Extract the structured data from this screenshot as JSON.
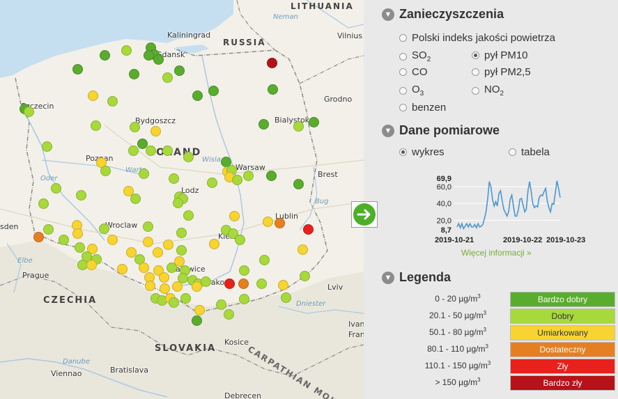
{
  "map": {
    "labels": {
      "poland": "POLAND",
      "czechia": "CZECHIA",
      "slovakia": "SLOVAKIA",
      "russia": "RUSSIA",
      "lithuania": "LITHUANIA",
      "carpathian": "CARPATHIAN MOU",
      "neman": "Neman",
      "kaliningrad": "Kaliningrad",
      "vilnius": "Vilnius",
      "gdansk": "Gdansk",
      "szczecin": "Szczecin",
      "bydgoszcz": "Bydgoszcz",
      "bialystok": "Bialystok",
      "grodno": "Grodno",
      "poznan": "Poznan",
      "warsaw": "Warsaw",
      "brest": "Brest",
      "lodz": "Lodz",
      "wroclaw": "Wroclaw",
      "lublin": "Lublin",
      "kielce": "Kielce",
      "katowice": "Katowice",
      "krakow": "Krakow",
      "prague": "Prague",
      "lviv": "Lviv",
      "kosice": "Kosice",
      "bratislava": "Bratislava",
      "vienna": "Viennao",
      "dresden": "sden",
      "debrecen": "Debrecen",
      "ivano": "Ivan",
      "frank": "Fran",
      "danube": "Danube",
      "elbe": "Elbe",
      "oder": "Oder",
      "warta": "Warta",
      "wisla": "Wisla",
      "bug": "Bug",
      "dniester": "Dniester"
    },
    "stations": [
      {
        "x": 150,
        "y": 79,
        "c": "green"
      },
      {
        "x": 181,
        "y": 72,
        "c": "lime"
      },
      {
        "x": 216,
        "y": 68,
        "c": "green"
      },
      {
        "x": 221,
        "y": 78,
        "c": "green"
      },
      {
        "x": 213,
        "y": 79,
        "c": "green"
      },
      {
        "x": 227,
        "y": 85,
        "c": "green"
      },
      {
        "x": 111,
        "y": 99,
        "c": "green"
      },
      {
        "x": 192,
        "y": 106,
        "c": "green"
      },
      {
        "x": 240,
        "y": 111,
        "c": "lime"
      },
      {
        "x": 257,
        "y": 101,
        "c": "green"
      },
      {
        "x": 390,
        "y": 90,
        "c": "darkred"
      },
      {
        "x": 391,
        "y": 128,
        "c": "green"
      },
      {
        "x": 306,
        "y": 130,
        "c": "green"
      },
      {
        "x": 283,
        "y": 137,
        "c": "green"
      },
      {
        "x": 133,
        "y": 137,
        "c": "yellow"
      },
      {
        "x": 161,
        "y": 145,
        "c": "lime"
      },
      {
        "x": 35,
        "y": 156,
        "c": "green"
      },
      {
        "x": 41,
        "y": 160,
        "c": "lime"
      },
      {
        "x": 137,
        "y": 180,
        "c": "lime"
      },
      {
        "x": 193,
        "y": 182,
        "c": "lime"
      },
      {
        "x": 223,
        "y": 188,
        "c": "yellow"
      },
      {
        "x": 378,
        "y": 178,
        "c": "green"
      },
      {
        "x": 428,
        "y": 181,
        "c": "lime"
      },
      {
        "x": 450,
        "y": 175,
        "c": "green"
      },
      {
        "x": 67,
        "y": 210,
        "c": "lime"
      },
      {
        "x": 204,
        "y": 206,
        "c": "green"
      },
      {
        "x": 191,
        "y": 216,
        "c": "lime"
      },
      {
        "x": 216,
        "y": 216,
        "c": "lime"
      },
      {
        "x": 240,
        "y": 216,
        "c": "lime"
      },
      {
        "x": 270,
        "y": 225,
        "c": "lime"
      },
      {
        "x": 324,
        "y": 232,
        "c": "green"
      },
      {
        "x": 145,
        "y": 233,
        "c": "yellow"
      },
      {
        "x": 151,
        "y": 245,
        "c": "lime"
      },
      {
        "x": 326,
        "y": 246,
        "c": "yellow"
      },
      {
        "x": 332,
        "y": 244,
        "c": "lime"
      },
      {
        "x": 329,
        "y": 254,
        "c": "yellow"
      },
      {
        "x": 340,
        "y": 258,
        "c": "lime"
      },
      {
        "x": 356,
        "y": 252,
        "c": "lime"
      },
      {
        "x": 389,
        "y": 252,
        "c": "green"
      },
      {
        "x": 206,
        "y": 249,
        "c": "lime"
      },
      {
        "x": 249,
        "y": 256,
        "c": "lime"
      },
      {
        "x": 304,
        "y": 262,
        "c": "lime"
      },
      {
        "x": 428,
        "y": 264,
        "c": "green"
      },
      {
        "x": 80,
        "y": 270,
        "c": "lime"
      },
      {
        "x": 184,
        "y": 274,
        "c": "yellow"
      },
      {
        "x": 116,
        "y": 280,
        "c": "lime"
      },
      {
        "x": 194,
        "y": 285,
        "c": "lime"
      },
      {
        "x": 257,
        "y": 282,
        "c": "lime"
      },
      {
        "x": 262,
        "y": 285,
        "c": "lime"
      },
      {
        "x": 255,
        "y": 291,
        "c": "lime"
      },
      {
        "x": 270,
        "y": 309,
        "c": "lime"
      },
      {
        "x": 62,
        "y": 292,
        "c": "lime"
      },
      {
        "x": 336,
        "y": 310,
        "c": "yellow"
      },
      {
        "x": 384,
        "y": 318,
        "c": "yellow"
      },
      {
        "x": 401,
        "y": 320,
        "c": "orange"
      },
      {
        "x": 442,
        "y": 329,
        "c": "red"
      },
      {
        "x": 69,
        "y": 329,
        "c": "lime"
      },
      {
        "x": 110,
        "y": 323,
        "c": "yellow"
      },
      {
        "x": 111,
        "y": 335,
        "c": "yellow"
      },
      {
        "x": 149,
        "y": 328,
        "c": "lime"
      },
      {
        "x": 212,
        "y": 325,
        "c": "lime"
      },
      {
        "x": 260,
        "y": 334,
        "c": "lime"
      },
      {
        "x": 324,
        "y": 330,
        "c": "lime"
      },
      {
        "x": 334,
        "y": 335,
        "c": "lime"
      },
      {
        "x": 55,
        "y": 340,
        "c": "orange"
      },
      {
        "x": 91,
        "y": 344,
        "c": "lime"
      },
      {
        "x": 161,
        "y": 344,
        "c": "yellow"
      },
      {
        "x": 212,
        "y": 347,
        "c": "yellow"
      },
      {
        "x": 241,
        "y": 351,
        "c": "yellow"
      },
      {
        "x": 307,
        "y": 350,
        "c": "yellow"
      },
      {
        "x": 344,
        "y": 344,
        "c": "lime"
      },
      {
        "x": 114,
        "y": 355,
        "c": "lime"
      },
      {
        "x": 132,
        "y": 357,
        "c": "yellow"
      },
      {
        "x": 188,
        "y": 362,
        "c": "yellow"
      },
      {
        "x": 226,
        "y": 362,
        "c": "yellow"
      },
      {
        "x": 260,
        "y": 359,
        "c": "lime"
      },
      {
        "x": 434,
        "y": 358,
        "c": "yellow"
      },
      {
        "x": 124,
        "y": 368,
        "c": "lime"
      },
      {
        "x": 138,
        "y": 372,
        "c": "lime"
      },
      {
        "x": 200,
        "y": 372,
        "c": "lime"
      },
      {
        "x": 257,
        "y": 375,
        "c": "yellow"
      },
      {
        "x": 379,
        "y": 373,
        "c": "lime"
      },
      {
        "x": 118,
        "y": 380,
        "c": "lime"
      },
      {
        "x": 131,
        "y": 380,
        "c": "yellow"
      },
      {
        "x": 175,
        "y": 386,
        "c": "yellow"
      },
      {
        "x": 206,
        "y": 384,
        "c": "yellow"
      },
      {
        "x": 227,
        "y": 388,
        "c": "yellow"
      },
      {
        "x": 246,
        "y": 384,
        "c": "lime"
      },
      {
        "x": 265,
        "y": 388,
        "c": "lime"
      },
      {
        "x": 350,
        "y": 388,
        "c": "lime"
      },
      {
        "x": 214,
        "y": 398,
        "c": "yellow"
      },
      {
        "x": 235,
        "y": 398,
        "c": "yellow"
      },
      {
        "x": 262,
        "y": 399,
        "c": "lime"
      },
      {
        "x": 276,
        "y": 402,
        "c": "lime"
      },
      {
        "x": 284,
        "y": 407,
        "c": "lime"
      },
      {
        "x": 282,
        "y": 411,
        "c": "yellow"
      },
      {
        "x": 295,
        "y": 404,
        "c": "lime"
      },
      {
        "x": 329,
        "y": 407,
        "c": "red"
      },
      {
        "x": 349,
        "y": 407,
        "c": "orange"
      },
      {
        "x": 375,
        "y": 407,
        "c": "lime"
      },
      {
        "x": 406,
        "y": 409,
        "c": "yellow"
      },
      {
        "x": 437,
        "y": 396,
        "c": "lime"
      },
      {
        "x": 215,
        "y": 410,
        "c": "yellow"
      },
      {
        "x": 236,
        "y": 414,
        "c": "yellow"
      },
      {
        "x": 254,
        "y": 411,
        "c": "yellow"
      },
      {
        "x": 223,
        "y": 428,
        "c": "lime"
      },
      {
        "x": 232,
        "y": 431,
        "c": "lime"
      },
      {
        "x": 244,
        "y": 428,
        "c": "yellow"
      },
      {
        "x": 249,
        "y": 434,
        "c": "lime"
      },
      {
        "x": 266,
        "y": 428,
        "c": "lime"
      },
      {
        "x": 317,
        "y": 437,
        "c": "lime"
      },
      {
        "x": 350,
        "y": 429,
        "c": "lime"
      },
      {
        "x": 410,
        "y": 427,
        "c": "lime"
      },
      {
        "x": 286,
        "y": 445,
        "c": "yellow"
      },
      {
        "x": 328,
        "y": 451,
        "c": "lime"
      },
      {
        "x": 282,
        "y": 460,
        "c": "green"
      }
    ]
  },
  "colors": {
    "green": "#5aac2e",
    "lime": "#a8d93c",
    "yellow": "#f7d431",
    "orange": "#e57f21",
    "red": "#e8211d",
    "darkred": "#b5121a",
    "link": "#76ae35",
    "line": "#4a96d1"
  },
  "next_button": {
    "icon": "arrow-right-icon"
  },
  "pollutants": {
    "title": "Zanieczyszczenia",
    "options": {
      "pij": "Polski indeks jakości powietrza",
      "so2": "SO",
      "so2_sub": "2",
      "co": "CO",
      "o3": "O",
      "o3_sub": "3",
      "benzen": "benzen",
      "pm10": "pył PM10",
      "pm25": "pył PM2,5",
      "no2": "NO",
      "no2_sub": "2"
    },
    "selected": "pył PM10"
  },
  "measurements": {
    "title": "Dane pomiarowe",
    "views": {
      "chart": "wykres",
      "table": "tabela"
    },
    "selected": "wykres",
    "more_link": "Więcej informacji »"
  },
  "chart_data": {
    "type": "line",
    "y_ticks": [
      "69,9",
      "60,0",
      "40,0",
      "20,0",
      "8,7"
    ],
    "x_ticks": [
      "2019-10-21",
      "2019-10-22",
      "2019-10-23"
    ],
    "ylim": [
      8.7,
      69.9
    ],
    "series": [
      {
        "values": [
          12,
          16,
          11,
          16,
          10,
          13,
          16,
          12,
          16,
          12,
          12,
          15,
          11,
          16,
          12,
          13,
          15,
          22,
          30,
          45,
          66,
          60,
          45,
          37,
          42,
          37,
          52,
          55,
          43,
          33,
          29,
          25,
          30,
          45,
          50,
          37,
          25,
          25,
          32,
          45,
          46,
          38,
          30,
          33,
          55,
          66,
          54,
          40,
          35,
          37,
          36,
          47,
          50,
          49,
          54,
          58,
          43,
          35,
          30,
          40,
          39,
          53,
          67,
          58,
          47
        ]
      }
    ]
  },
  "legend": {
    "title": "Legenda",
    "unit": "µg/m",
    "unit_sup": "3",
    "items": [
      {
        "range": "0 - 20",
        "label": "Bardzo dobry",
        "color": "#5aac2e",
        "text": "#ffffff"
      },
      {
        "range": "20.1 - 50",
        "label": "Dobry",
        "color": "#a8d93c",
        "text": "#333333"
      },
      {
        "range": "50.1 - 80",
        "label": "Umiarkowany",
        "color": "#f7d431",
        "text": "#333333"
      },
      {
        "range": "80.1 - 110",
        "label": "Dostateczny",
        "color": "#e57f21",
        "text": "#ffffff"
      },
      {
        "range": "110.1 - 150",
        "label": "Zły",
        "color": "#e8211d",
        "text": "#ffffff"
      },
      {
        "range": "> 150",
        "label": "Bardzo zły",
        "color": "#b5121a",
        "text": "#ffffff"
      }
    ]
  }
}
